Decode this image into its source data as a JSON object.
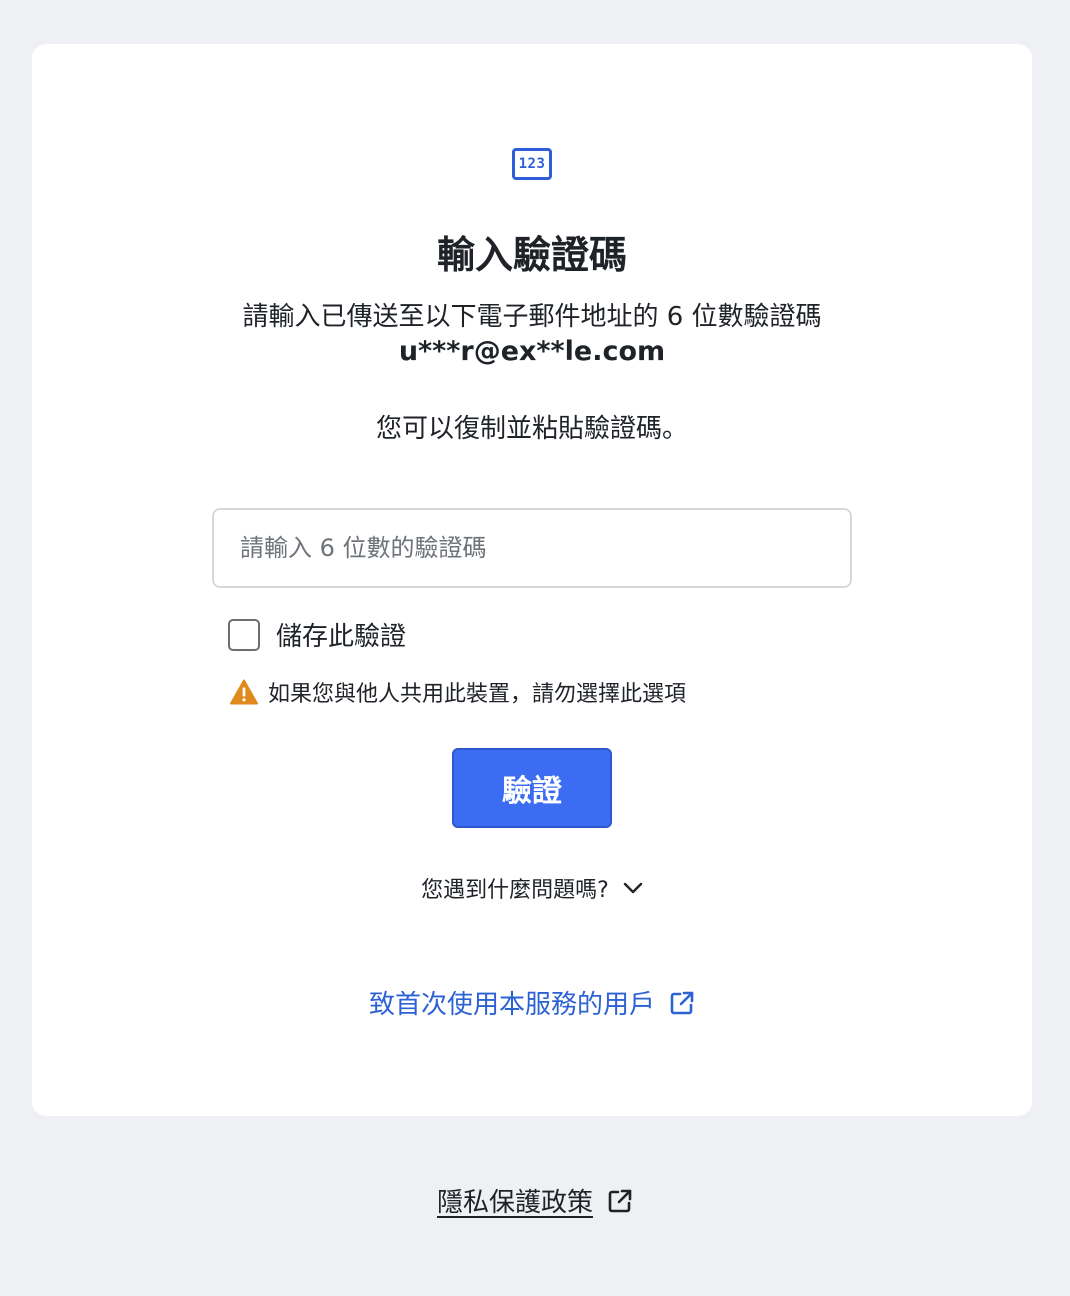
{
  "card": {
    "icon_text": "123",
    "title": "輸入驗證碼",
    "subtitle": "請輸入已傳送至以下電子郵件地址的 6 位數驗證碼",
    "email": "u***r@ex**le.com",
    "hint": "您可以復制並粘貼驗證碼。"
  },
  "form": {
    "code_value": "",
    "code_placeholder": "請輸入 6 位數的驗證碼",
    "remember_label": "儲存此驗證",
    "remember_checked": false,
    "warning_text": "如果您與他人共用此裝置，請勿選擇此選項",
    "verify_label": "驗證"
  },
  "help": {
    "trouble_label": "您遇到什麼問題嗎?",
    "first_time_label": "致首次使用本服務的用戶"
  },
  "footer": {
    "privacy_label": "隱私保護政策"
  },
  "icons": {
    "code": "numeric-code-icon",
    "warning": "warning-triangle-icon",
    "chevron": "chevron-down-icon",
    "external": "external-link-icon"
  },
  "colors": {
    "page_background": "#eef0f3",
    "card_background": "#ffffff",
    "accent": "#3b6cf2",
    "link": "#2c62d3",
    "warning": "#e08a1e",
    "text": "#1f2328"
  }
}
